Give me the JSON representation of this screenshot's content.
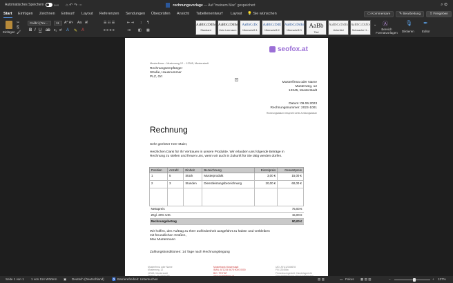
{
  "titlebar": {
    "autosave_label": "Automatisches Speichern",
    "toggle_state": "aus",
    "doc_title": "rechnungsvorlage",
    "save_state": " — Auf \"meinem Mac\" gespeichert",
    "right_icons": "⌕  ⚙"
  },
  "menu": {
    "tabs": [
      "Start",
      "Einfügen",
      "Zeichnen",
      "Entwurf",
      "Layout",
      "Referenzen",
      "Sendungen",
      "Überprüfen",
      "Ansicht",
      "Tabellenentwurf",
      "Layout"
    ],
    "tell_me": "Sie wünschen",
    "comments": "Kommentare",
    "editing": "Bearbeitung",
    "share": "Freigeben"
  },
  "ribbon": {
    "paste_label": "Einfügen",
    "font_name": "Calibri (Tex...",
    "font_size": "11",
    "styles": [
      {
        "sample": "AaBbCcDdEe",
        "name": "Standard"
      },
      {
        "sample": "AaBbCcDdEe",
        "name": "Kein Leerraum"
      },
      {
        "sample": "AaBbCcDc",
        "name": "Überschrift 1"
      },
      {
        "sample": "AaBbCcDdE",
        "name": "Überschrift 2"
      },
      {
        "sample": "AaBbCcDdEe",
        "name": "Überschrift 3"
      },
      {
        "sample": "AaBb",
        "name": "Titel"
      },
      {
        "sample": "AaBbCcDdEe",
        "name": "Untertitel"
      },
      {
        "sample": "AaBbCcDdEe",
        "name": "Schwache H..."
      }
    ],
    "styles_pane": "Bereich Formatvorlagen",
    "dictate": "Diktieren",
    "editor": "Editor"
  },
  "document": {
    "logo_text": "seofox.at",
    "sender_line": "Musterfirma – Musterweg 12 – 12345, Musterstadt",
    "recipient": [
      "Rechnungsempfänger",
      "Straße, Hausnummer",
      "PLZ, Ort"
    ],
    "sender_block": [
      "Musterfirma oder Name",
      "Musterweg, 12",
      "12345, Musterstadt"
    ],
    "date_line": "Datum: 09.06.2023",
    "invoice_number": "Rechnungsnummer: 2023-1001",
    "delivery_note": "Rechnungsdatum entspricht Liefer-/Leistungsdatum",
    "heading": "Rechnung",
    "greeting": "Sehr geehrter Herr Maier,",
    "intro_1": "Herzlichen Dank für Ihr Vertrauen in unsere Produkte. Wir erlauben uns folgende Beträge in",
    "intro_2": "Rechnung zu stellen und freuen uns, wenn wir auch in Zukunft für Sie tätig werden dürfen.",
    "table": {
      "headers": [
        "Position",
        "Anzahl",
        "Einheit",
        "Bezeichnung",
        "Einzelpreis",
        "Gesamtpreis"
      ],
      "rows": [
        [
          "1",
          "5",
          "Stück",
          "Musterprodukt",
          "3,00 €",
          "15,00 €"
        ],
        [
          "2",
          "3",
          "Stunden",
          "Dienstleistungsbezeichnung",
          "20,00 €",
          "60,00 €"
        ]
      ],
      "net_label": "Nettopreis",
      "net_value": "75,00 €",
      "tax_label": "Zzgl. 20% USt.",
      "tax_value": "15,00 €",
      "total_label": "Rechnungsbetrag",
      "total_value": "90,00 €"
    },
    "closing_1": "Wir hoffen, den Auftrag zu Ihrer Zufriedenheit ausgeführt zu haben und verbleiben",
    "closing_2": "mit freundlichen Grüßen,",
    "closing_3": "Max Mustermann",
    "payment_terms": "Zahlungskonditionen: 14 Tage nach Rechnungslegung",
    "footer": [
      [
        "Musterfirma oder Name",
        "Musterweg, 12",
        "12345, Musterstadt",
        "Telefon: 0123456789"
      ],
      [
        "Musterbank Musterstadt",
        "IBAN: AT1234 5678 9000 0000",
        "BIC: TESTAT",
        "www.musterfirma.at"
      ],
      [
        "UID: ATU12345678",
        "FN 123456a",
        "Firmenbuchgericht: Handelsgericht",
        "Geschäftsführung: Max Mustermann"
      ]
    ]
  },
  "status": {
    "page": "Seite 1 von 1",
    "words": "1 von 114 Wörtern",
    "language": "Deutsch (Deutschland)",
    "accessibility": "Barrierefreiheit: Untersuchen",
    "focus": "Fokus",
    "zoom": "137%"
  }
}
